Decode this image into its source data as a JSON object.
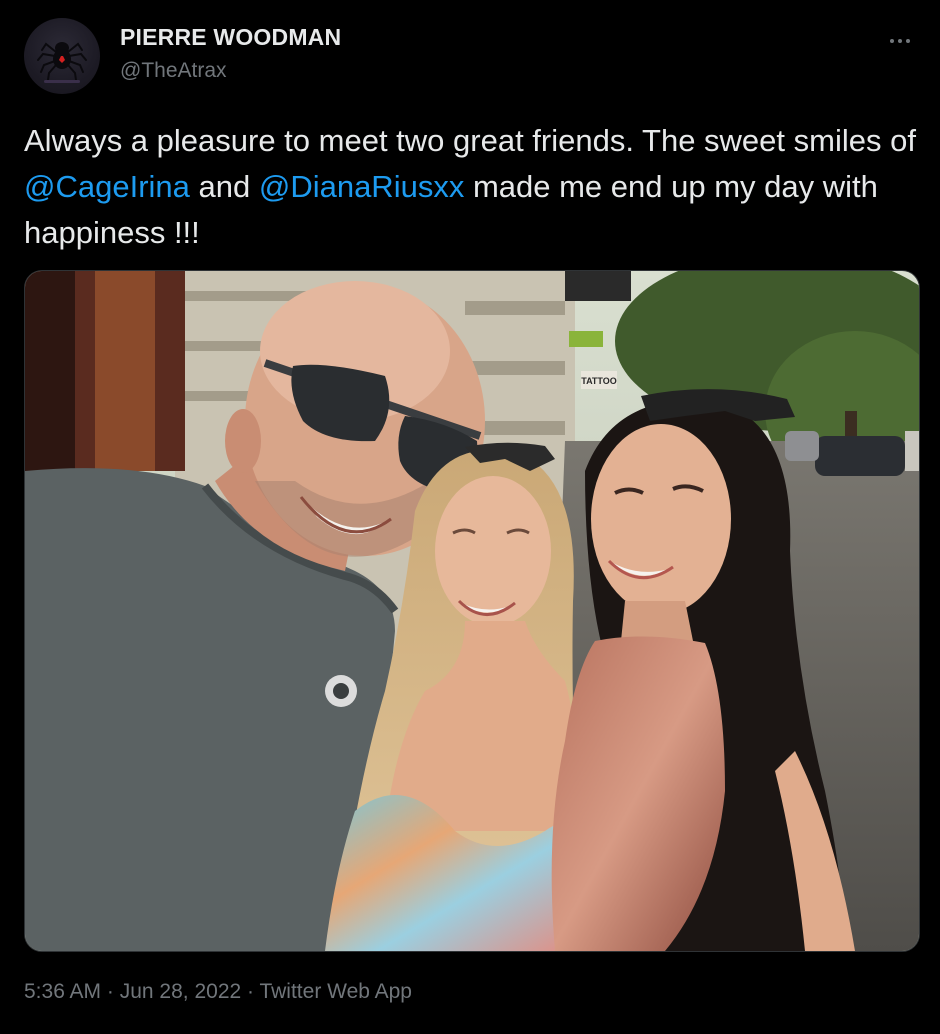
{
  "author": {
    "display_name": "PIERRE WOODMAN",
    "handle": "@TheAtrax",
    "avatar_icon": "spider-logo-icon"
  },
  "menu": {
    "icon": "more-options-icon"
  },
  "tweet": {
    "text_before": "Always a pleasure to meet two great friends. The sweet smiles of ",
    "mention_1": "@CageIrina",
    "text_middle": " and ",
    "mention_2": "@DianaRiusxx",
    "text_after": " made me end up my day with happiness !!!"
  },
  "photo": {
    "shop_sign": "TATTOO"
  },
  "meta": {
    "time": "5:36 AM",
    "separator": " · ",
    "date": "Jun 28, 2022",
    "source": "Twitter Web App"
  },
  "colors": {
    "background": "#000000",
    "primary_text": "#e7e9ea",
    "secondary_text": "#71767b",
    "link": "#1d9bf0"
  }
}
